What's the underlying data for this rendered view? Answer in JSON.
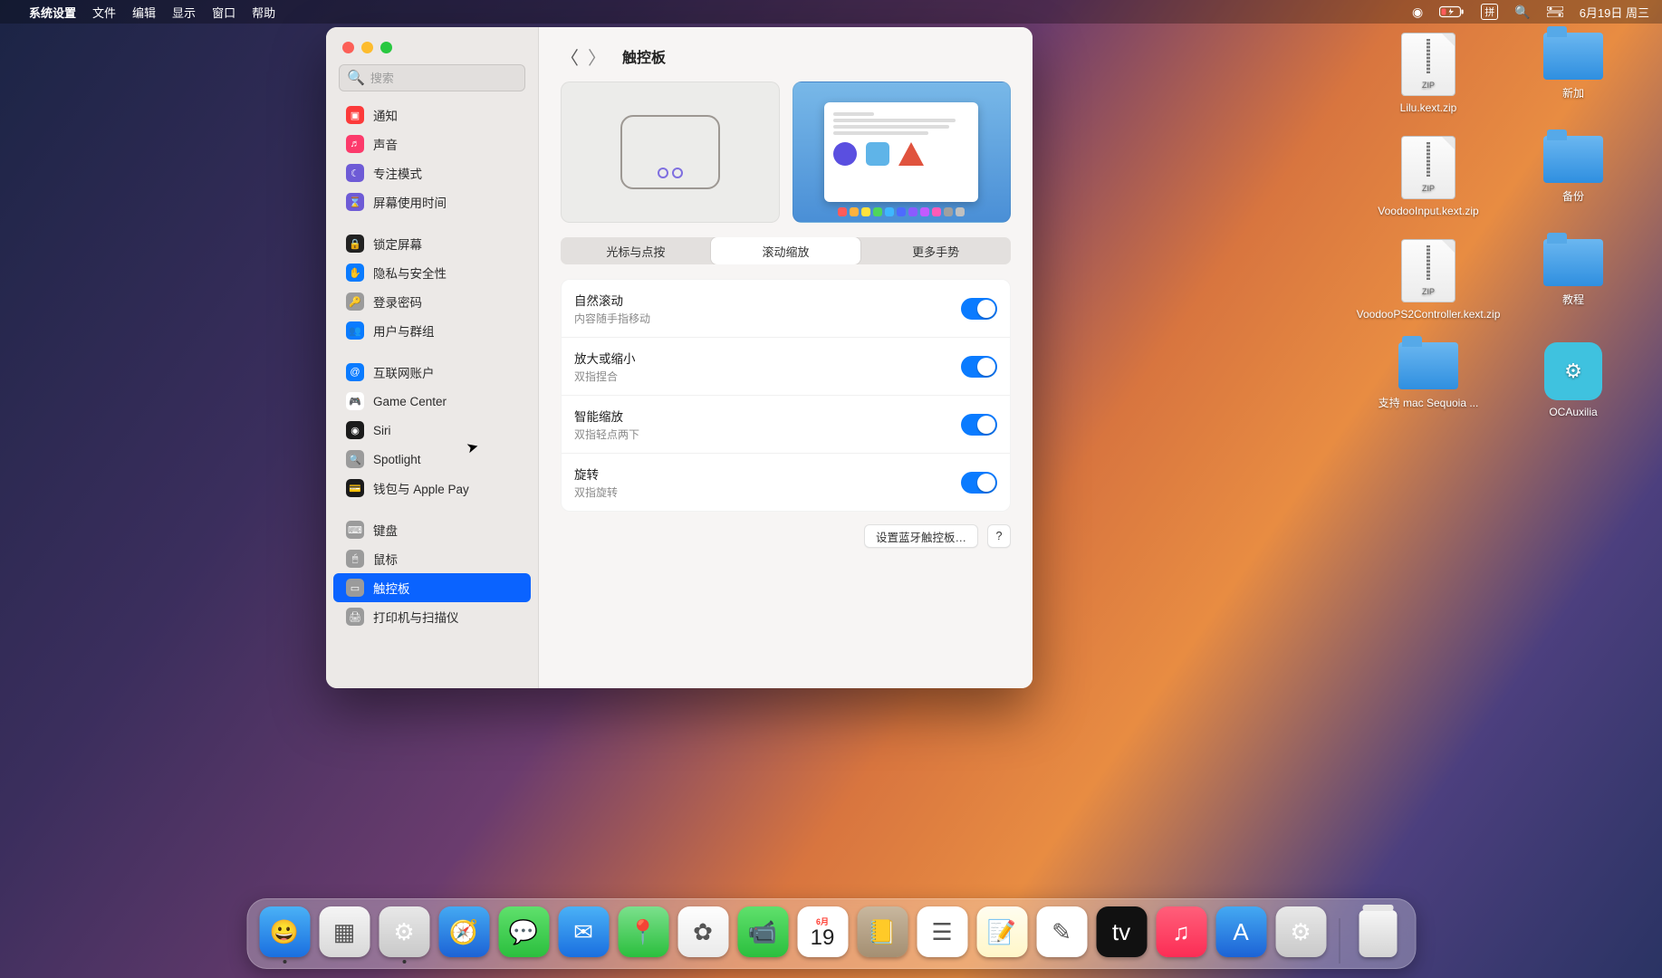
{
  "menubar": {
    "app": "系统设置",
    "items": [
      "文件",
      "编辑",
      "显示",
      "窗口",
      "帮助"
    ],
    "right": {
      "ime": "拼",
      "date": "6月19日 周三"
    }
  },
  "desktop": {
    "items": [
      {
        "name": "Lilu.kext.zip",
        "type": "zip"
      },
      {
        "name": "新加",
        "type": "folder"
      },
      {
        "name": "VoodooInput.kext.zip",
        "type": "zip"
      },
      {
        "name": "备份",
        "type": "folder"
      },
      {
        "name": "VoodooPS2Controller.kext.zip",
        "type": "zip"
      },
      {
        "name": "教程",
        "type": "folder"
      },
      {
        "name": "支持 mac Sequoia ...",
        "type": "folder"
      },
      {
        "name": "OCAuxilia",
        "type": "app"
      }
    ]
  },
  "window": {
    "search_placeholder": "搜索",
    "title": "触控板",
    "sidebar": [
      {
        "label": "通知",
        "color": "#fc3a3a",
        "glyph": "▣"
      },
      {
        "label": "声音",
        "color": "#fc3a6b",
        "glyph": "♬"
      },
      {
        "label": "专注模式",
        "color": "#6e5bd6",
        "glyph": "☾"
      },
      {
        "label": "屏幕使用时间",
        "color": "#6e5bd6",
        "glyph": "⌛"
      },
      {
        "spacer": true
      },
      {
        "label": "锁定屏幕",
        "color": "#222222",
        "glyph": "🔒"
      },
      {
        "label": "隐私与安全性",
        "color": "#0a7bff",
        "glyph": "✋"
      },
      {
        "label": "登录密码",
        "color": "#9b9b9b",
        "glyph": "🔑"
      },
      {
        "label": "用户与群组",
        "color": "#0a7bff",
        "glyph": "👥"
      },
      {
        "spacer": true
      },
      {
        "label": "互联网账户",
        "color": "#0a7bff",
        "glyph": "@"
      },
      {
        "label": "Game Center",
        "color": "#ffffff",
        "glyph": "🎮",
        "text_color": "#333"
      },
      {
        "label": "Siri",
        "color": "#1b1b1b",
        "glyph": "◉"
      },
      {
        "label": "Spotlight",
        "color": "#9b9b9b",
        "glyph": "🔍"
      },
      {
        "label": "钱包与 Apple Pay",
        "color": "#1b1b1b",
        "glyph": "💳"
      },
      {
        "spacer": true
      },
      {
        "label": "键盘",
        "color": "#9b9b9b",
        "glyph": "⌨"
      },
      {
        "label": "鼠标",
        "color": "#9b9b9b",
        "glyph": "🖱"
      },
      {
        "label": "触控板",
        "color": "#9b9b9b",
        "glyph": "▭",
        "selected": true
      },
      {
        "label": "打印机与扫描仪",
        "color": "#9b9b9b",
        "glyph": "🖨"
      }
    ],
    "tabs": [
      "光标与点按",
      "滚动缩放",
      "更多手势"
    ],
    "active_tab": 1,
    "settings": [
      {
        "title": "自然滚动",
        "sub": "内容随手指移动",
        "on": true
      },
      {
        "title": "放大或缩小",
        "sub": "双指捏合",
        "on": true
      },
      {
        "title": "智能缩放",
        "sub": "双指轻点两下",
        "on": true
      },
      {
        "title": "旋转",
        "sub": "双指旋转",
        "on": true
      }
    ],
    "footer": {
      "bluetooth": "设置蓝牙触控板…",
      "help": "?"
    }
  },
  "dock": {
    "items": [
      {
        "name": "finder",
        "bg": "linear-gradient(#4ab1f6,#1a6fe0)",
        "glyph": "😀",
        "running": true
      },
      {
        "name": "launchpad",
        "bg": "linear-gradient(#f5f5f5,#d8d8d8)",
        "glyph": "▦"
      },
      {
        "name": "settings",
        "bg": "linear-gradient(#e8e8e8,#c9c9c9)",
        "glyph": "⚙",
        "running": true
      },
      {
        "name": "safari",
        "bg": "linear-gradient(#44a9f2,#1c63d6)",
        "glyph": "🧭"
      },
      {
        "name": "messages",
        "bg": "linear-gradient(#5fe06c,#2bbf3e)",
        "glyph": "💬"
      },
      {
        "name": "mail",
        "bg": "linear-gradient(#4ab1f6,#1a6fe0)",
        "glyph": "✉"
      },
      {
        "name": "maps",
        "bg": "linear-gradient(#7be08c,#2bbf3e)",
        "glyph": "📍"
      },
      {
        "name": "photos",
        "bg": "linear-gradient(#fefefe,#eaeaea)",
        "glyph": "✿"
      },
      {
        "name": "facetime",
        "bg": "linear-gradient(#5fe06c,#2bbf3e)",
        "glyph": "📹"
      },
      {
        "name": "calendar",
        "bg": "#fff",
        "glyph": "19",
        "top": "6月"
      },
      {
        "name": "contacts",
        "bg": "linear-gradient(#c8b79e,#a48f72)",
        "glyph": "📒"
      },
      {
        "name": "reminders",
        "bg": "#fff",
        "glyph": "☰"
      },
      {
        "name": "notes",
        "bg": "linear-gradient(#fffdf0,#fff6c8)",
        "glyph": "📝"
      },
      {
        "name": "freeform",
        "bg": "#fff",
        "glyph": "✎"
      },
      {
        "name": "tv",
        "bg": "#111",
        "glyph": "tv"
      },
      {
        "name": "music",
        "bg": "linear-gradient(#ff5f7a,#fc2d55)",
        "glyph": "♫"
      },
      {
        "name": "appstore",
        "bg": "linear-gradient(#44a9f2,#1c63d6)",
        "glyph": "A"
      },
      {
        "name": "syspref",
        "bg": "linear-gradient(#e8e8e8,#c9c9c9)",
        "glyph": "⚙"
      }
    ]
  }
}
